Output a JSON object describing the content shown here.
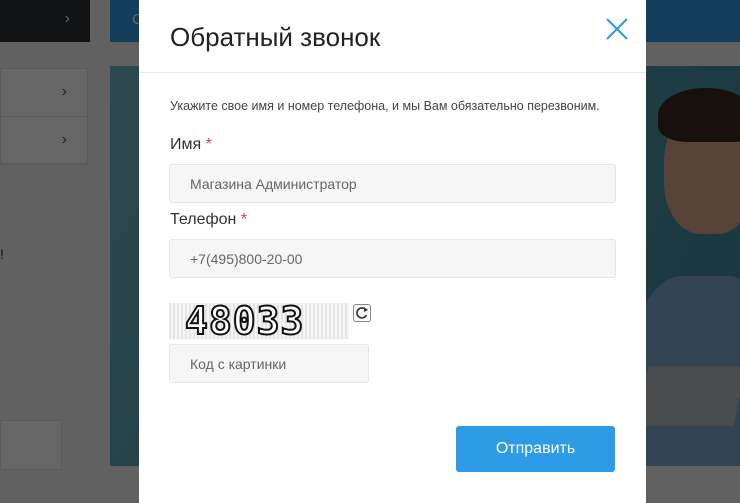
{
  "background": {
    "banner_text_fragment": "С",
    "exclamation": "!"
  },
  "modal": {
    "title": "Обратный звонок",
    "close_icon": "close-icon",
    "hint": "Укажите свое имя и номер телефона, и мы Вам обязательно перезвоним.",
    "name": {
      "label": "Имя",
      "required_mark": "*",
      "placeholder": "Магазина Администратор"
    },
    "phone": {
      "label": "Телефон",
      "required_mark": "*",
      "placeholder": "+7(495)800-20-00"
    },
    "captcha": {
      "code": "48033",
      "refresh_icon": "refresh-icon",
      "placeholder": "Код с картинки"
    },
    "submit_label": "Отправить"
  },
  "colors": {
    "accent": "#2e9be6",
    "required": "#e53935"
  }
}
